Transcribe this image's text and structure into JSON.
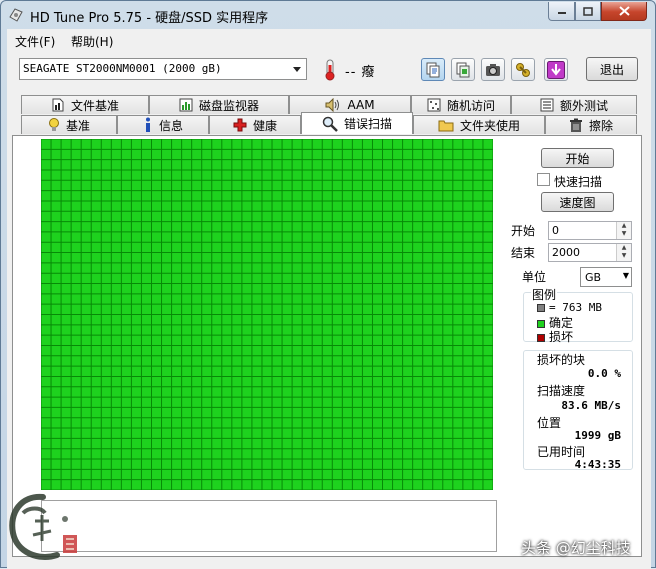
{
  "window": {
    "title": "HD Tune Pro 5.75 - 硬盘/SSD 实用程序"
  },
  "menu": {
    "file": "文件(F)",
    "help": "帮助(H)"
  },
  "toolbar": {
    "drive": "SEAGATE ST2000NM0001 (2000 gB)",
    "temperature": "-- 癈",
    "exit_label": "退出",
    "tool_icons": [
      "copy-info-icon",
      "copy-screen-icon",
      "camera-icon",
      "wrench-icon",
      "download-icon"
    ]
  },
  "tabs": {
    "row1": [
      "文件基准",
      "磁盘监视器",
      "AAM",
      "随机访问",
      "额外测试"
    ],
    "row2": [
      "基准",
      "信息",
      "健康",
      "错误扫描",
      "文件夹使用",
      "擦除"
    ],
    "selected": "错误扫描"
  },
  "scan": {
    "grid_cols": 45,
    "grid_rows": 34,
    "ok_color": "#1ed21e",
    "grid_line_color": "#078a07",
    "damaged_blocks": 0
  },
  "controls": {
    "start_button": "开始",
    "quick_scan_label": "快速扫描",
    "quick_scan_checked": false,
    "speed_map_button": "速度图",
    "start_label": "开始",
    "start_value": "0",
    "end_label": "结束",
    "end_value": "2000",
    "unit_label": "单位",
    "unit_value": "GB"
  },
  "legend": {
    "title": "图例",
    "block_size": "= 763 MB",
    "ok_label": "确定",
    "bad_label": "损坏",
    "block_color": "#808080",
    "ok_color": "#1ed21e",
    "bad_color": "#b00000"
  },
  "stats": {
    "damaged_label": "损坏的块",
    "damaged_value": "0.0 %",
    "speed_label": "扫描速度",
    "speed_value": "83.6 MB/s",
    "position_label": "位置",
    "position_value": "1999 gB",
    "elapsed_label": "已用时间",
    "elapsed_value": "4:43:35"
  },
  "watermark": {
    "text": "头条 @幻尘科技"
  }
}
